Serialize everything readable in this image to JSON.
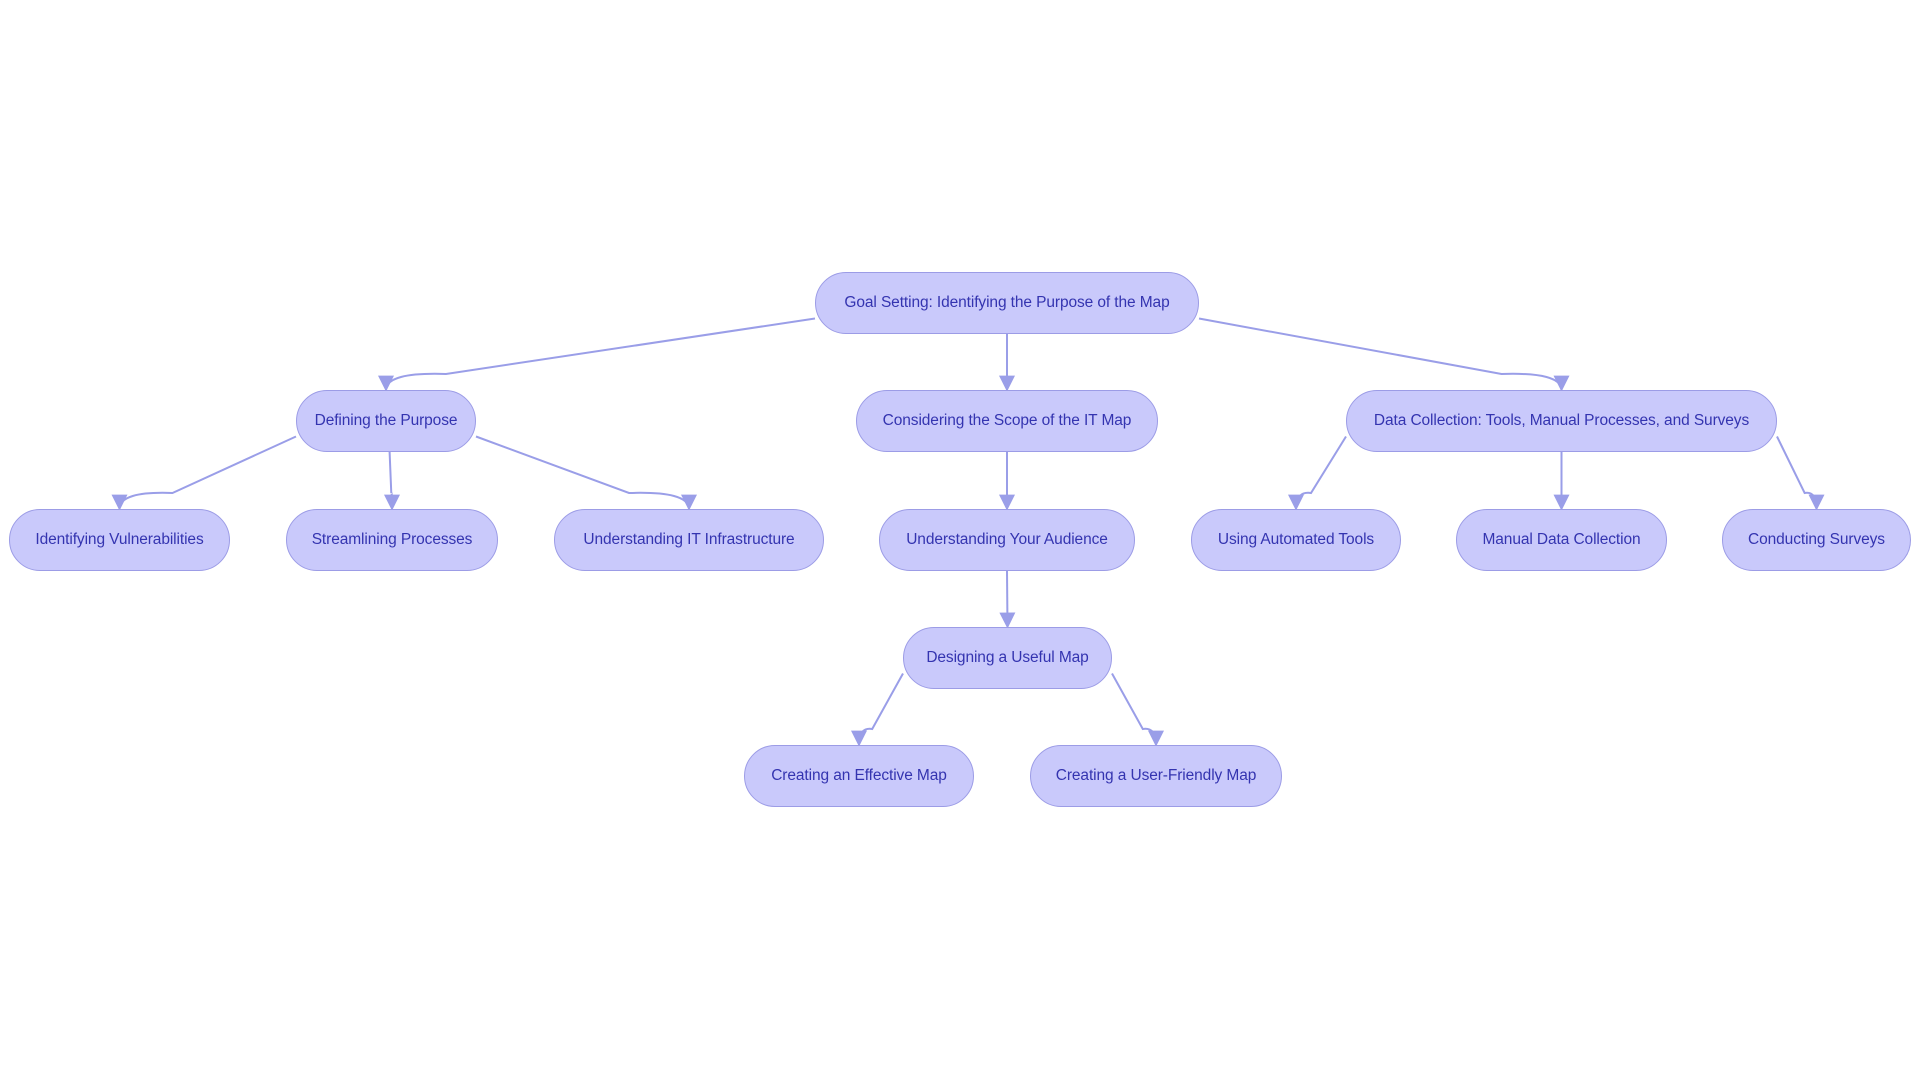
{
  "diagram": {
    "type": "flowchart",
    "colors": {
      "node_fill": "#c9c9fb",
      "node_border": "#9c9ce6",
      "text": "#3434b0",
      "edge": "#9a9ee8"
    },
    "nodes": [
      {
        "id": "root",
        "label": "Goal Setting: Identifying the Purpose of the Map"
      },
      {
        "id": "purpose",
        "label": "Defining the Purpose"
      },
      {
        "id": "scope",
        "label": "Considering the Scope of the IT Map"
      },
      {
        "id": "data",
        "label": "Data Collection: Tools, Manual Processes, and Surveys"
      },
      {
        "id": "vuln",
        "label": "Identifying Vulnerabilities"
      },
      {
        "id": "stream",
        "label": "Streamlining Processes"
      },
      {
        "id": "infra",
        "label": "Understanding IT Infrastructure"
      },
      {
        "id": "audience",
        "label": "Understanding Your Audience"
      },
      {
        "id": "auto",
        "label": "Using Automated Tools"
      },
      {
        "id": "manual",
        "label": "Manual Data Collection"
      },
      {
        "id": "surveys",
        "label": "Conducting Surveys"
      },
      {
        "id": "design",
        "label": "Designing a Useful Map"
      },
      {
        "id": "effective",
        "label": "Creating an Effective Map"
      },
      {
        "id": "friendly",
        "label": "Creating a User-Friendly Map"
      }
    ],
    "edges": [
      {
        "from": "root",
        "to": "purpose"
      },
      {
        "from": "root",
        "to": "scope"
      },
      {
        "from": "root",
        "to": "data"
      },
      {
        "from": "purpose",
        "to": "vuln"
      },
      {
        "from": "purpose",
        "to": "stream"
      },
      {
        "from": "purpose",
        "to": "infra"
      },
      {
        "from": "scope",
        "to": "audience"
      },
      {
        "from": "data",
        "to": "auto"
      },
      {
        "from": "data",
        "to": "manual"
      },
      {
        "from": "data",
        "to": "surveys"
      },
      {
        "from": "audience",
        "to": "design"
      },
      {
        "from": "design",
        "to": "effective"
      },
      {
        "from": "design",
        "to": "friendly"
      }
    ]
  }
}
